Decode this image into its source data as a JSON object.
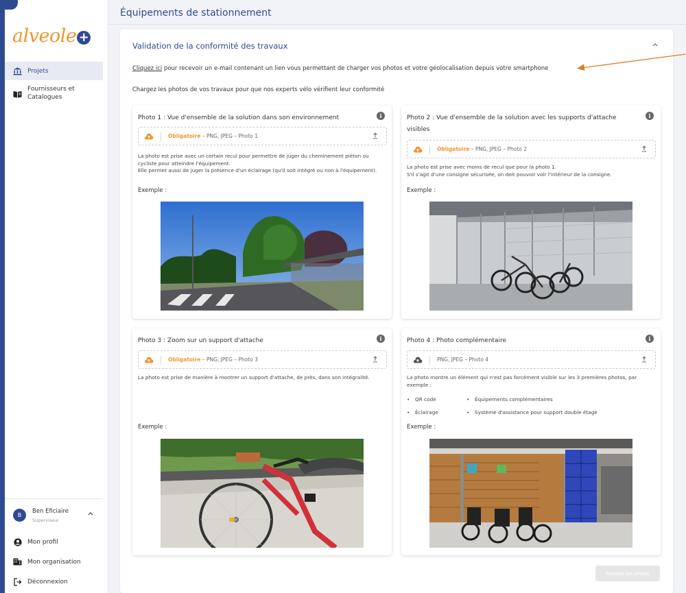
{
  "app": {
    "logo_text": "alveole",
    "logo_plus": "+"
  },
  "sidebar": {
    "items": [
      {
        "label": "Projets",
        "icon": "temple-icon"
      },
      {
        "label": "Fournisseurs et Catalogues",
        "icon": "book-icon"
      }
    ],
    "user": {
      "initial": "B",
      "name": "Ben Eficiaire",
      "role": "Superviseur"
    },
    "bottom_links": [
      {
        "label": "Mon profil",
        "icon": "user-icon"
      },
      {
        "label": "Mon organisation",
        "icon": "building-icon"
      },
      {
        "label": "Déconnexion",
        "icon": "logout-icon"
      }
    ]
  },
  "header": {
    "title": "Équipements de stationnement"
  },
  "panel": {
    "title": "Validation de la conformité des travaux",
    "email_link": "Cliquez ici",
    "email_text": " pour recevoir un e-mail contenant un lien vous permettant de charger vos photos et votre géolocalisation depuis votre smartphone",
    "instructions": "Chargez les photos de vos travaux pour que nos experts vélo vérifient leur conformité",
    "send_button": "Envoyer les photos"
  },
  "cards": [
    {
      "title": "Photo 1 : Vue d'ensemble de la solution dans son environnement",
      "required": "Obligatoire",
      "formats": " – PNG, JPEG – Photo 1",
      "desc": "La photo est prise avec un certain recul pour permettre de juger du cheminement piéton ou cycliste pour atteindre l'équipement.\nElle permet aussi de juger la présence d'un éclairage (qu'il soit intégré ou non à l'équipement).",
      "example": "Exemple :"
    },
    {
      "title": "Photo 2 : Vue d'ensemble de la solution avec les supports d'attache visibles",
      "required": "Obligatoire",
      "formats": " – PNG, JPEG – Photo 2",
      "desc": "La photo est prise avec moins de recul que pour la photo 1.\nS'il s'agit d'une consigne sécurisée, on doit pouvoir voir l'intérieur de la consigne.",
      "example": "Exemple :"
    },
    {
      "title": "Photo 3 : Zoom sur un support d'attache",
      "required": "Obligatoire",
      "formats": " – PNG, JPEG – Photo 3",
      "desc": "La photo est prise de manière à montrer un support d'attache, de près, dans son intégralité.",
      "example": "Exemple :"
    },
    {
      "title": "Photo 4 : Photo complémentaire",
      "formats": "PNG, JPEG – Photo 4",
      "desc": "La photo montre un élément qui n'est pas forcément visible sur les 3 premières photos, par exemple :",
      "list": [
        "QR code",
        "Éclairage",
        "Équipements complémentaires",
        "Système d'assistance pour support double étage"
      ],
      "example": "Exemple :"
    }
  ],
  "colors": {
    "brand": "#2f4b8f",
    "accent": "#f0962d",
    "annotation": "#e07b2a"
  }
}
